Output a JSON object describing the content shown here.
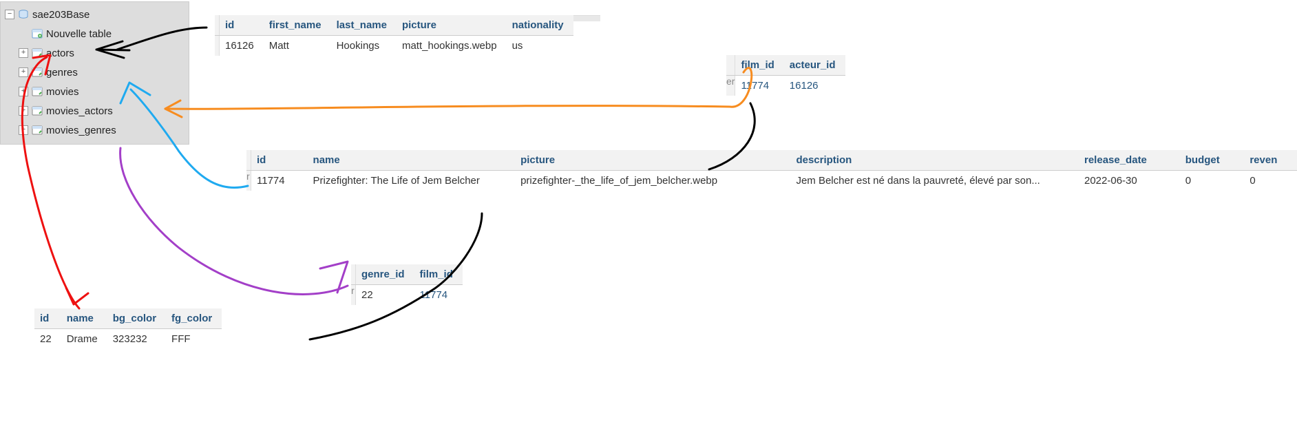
{
  "tree": {
    "db_name": "sae203Base",
    "new_table": "Nouvelle table",
    "items": [
      "actors",
      "genres",
      "movies",
      "movies_actors",
      "movies_genres"
    ]
  },
  "actors": {
    "headers": [
      "id",
      "first_name",
      "last_name",
      "picture",
      "nationality"
    ],
    "rows": [
      {
        "id": "16126",
        "first_name": "Matt",
        "last_name": "Hookings",
        "picture": "matt_hookings.webp",
        "nationality": "us"
      }
    ]
  },
  "movies_actors": {
    "headers": [
      "film_id",
      "acteur_id"
    ],
    "rows": [
      {
        "film_id": "11774",
        "acteur_id": "16126"
      }
    ],
    "edge_fragment": "er"
  },
  "movies": {
    "headers": [
      "id",
      "name",
      "picture",
      "description",
      "release_date",
      "budget",
      "reven"
    ],
    "rows": [
      {
        "id": "11774",
        "name": "Prizefighter: The Life of Jem Belcher",
        "picture": "prizefighter-_the_life_of_jem_belcher.webp",
        "description": "Jem Belcher est né dans la pauvreté, élevé par son...",
        "release_date": "2022-06-30",
        "budget": "0",
        "revenue": "0"
      }
    ],
    "edge_fragment": "r"
  },
  "movies_genres": {
    "headers": [
      "genre_id",
      "film_id"
    ],
    "rows": [
      {
        "genre_id": "22",
        "film_id": "11774"
      }
    ],
    "edge_fragment": "r"
  },
  "genres": {
    "headers": [
      "id",
      "name",
      "bg_color",
      "fg_color"
    ],
    "rows": [
      {
        "id": "22",
        "name": "Drame",
        "bg_color": "323232",
        "fg_color": "FFF"
      }
    ]
  },
  "colors": {
    "arrow_black": "#000000",
    "arrow_red": "#e11",
    "arrow_orange": "#f78c1f",
    "arrow_blue": "#1faaf0",
    "arrow_purple": "#a33fc8"
  }
}
